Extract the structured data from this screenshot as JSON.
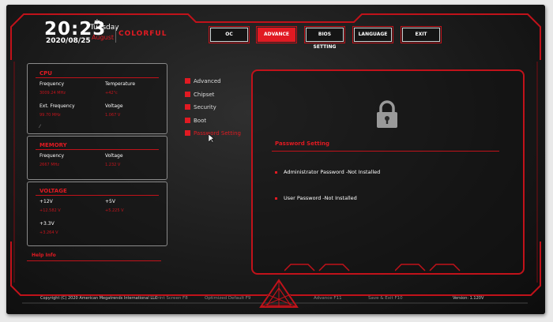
{
  "header": {
    "time": "20:23",
    "weekday": "Tuesday",
    "month": "August",
    "date": "2020/08/25",
    "brand": "COLORFUL"
  },
  "tabs": [
    {
      "label": "OC",
      "active": false
    },
    {
      "label": "ADVANCE",
      "active": true
    },
    {
      "label": "BIOS SETTING",
      "active": false
    },
    {
      "label": "LANGUAGE",
      "active": false
    },
    {
      "label": "EXIT",
      "active": false
    }
  ],
  "cpu": {
    "title": "CPU",
    "frequency_label": "Frequency",
    "frequency_value": "3009.24 MHz",
    "temperature_label": "Temperature",
    "temperature_value": "+42°c",
    "ext_frequency_label": "Ext. Frequency",
    "ext_frequency_value": "99.70 MHz",
    "voltage_label": "Voltage",
    "voltage_value": "1.067 V"
  },
  "memory": {
    "title": "MEMORY",
    "frequency_label": "Frequency",
    "frequency_value": "2667 MHz",
    "voltage_label": "Voltage",
    "voltage_value": "1.232 V"
  },
  "voltage": {
    "title": "VOLTAGE",
    "v12_label": "+12V",
    "v12_value": "+12.582 V",
    "v5_label": "+5V",
    "v5_value": "+5.225 V",
    "v33_label": "+3.3V",
    "v33_value": "+3.264 V"
  },
  "help": {
    "label": "Help Info"
  },
  "menu": [
    {
      "label": "Advanced",
      "active": false
    },
    {
      "label": "Chipset",
      "active": false
    },
    {
      "label": "Security",
      "active": false
    },
    {
      "label": "Boot",
      "active": false
    },
    {
      "label": "Password Setting",
      "active": true
    }
  ],
  "password": {
    "icon": "lock-icon",
    "title": "Password Setting",
    "admin": "Administrator Password -Not Installed",
    "user": "User Password -Not Installed"
  },
  "footer": {
    "copyright": "Copyright (C) 2020 American Megatrends International LLC",
    "print_screen": "Print Screen F8",
    "optimized_default": "Optimized Default F9",
    "advance": "Advance F11",
    "save_exit": "Save & Exit F10",
    "version": "Version: 1.120V"
  },
  "colors": {
    "accent": "#e11a22",
    "background": "#1a1a1a"
  }
}
